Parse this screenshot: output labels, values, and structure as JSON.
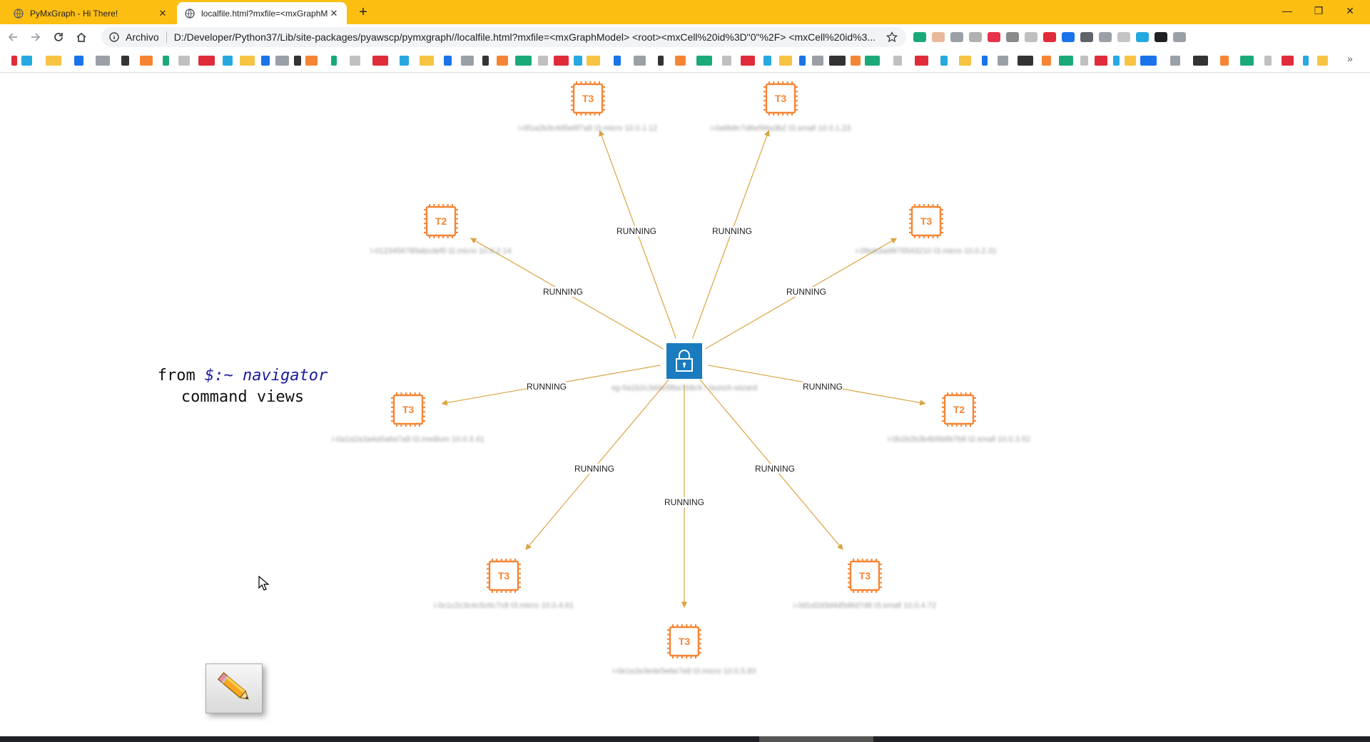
{
  "tabs": [
    {
      "title": "PyMxGraph - Hi There!",
      "active": false
    },
    {
      "title": "localfile.html?mxfile=<mxGraphM",
      "active": true
    }
  ],
  "toolbar": {
    "origin": "Archivo",
    "url": "D:/Developer/Python37/Lib/site-packages/pyawscp/pymxgraph//localfile.html?mxfile=<mxGraphModel> <root><mxCell%20id%3D\"0\"%2F> <mxCell%20id%3..."
  },
  "caption": {
    "line1_prefix": "from",
    "line1_prompt": "$:~",
    "line1_nav": "navigator",
    "line2": "command views"
  },
  "diagram": {
    "center_label": "sg-0a1b2c3d4e5f6a7b8c9 / launch-wizard",
    "nodes": [
      {
        "type": "T3",
        "label": "i-0f1a2b3c4d5e6f7a8 t3.micro 10.0.1.12"
      },
      {
        "type": "T3",
        "label": "i-0a9b8c7d6e5f4a3b2 t3.small 10.0.1.23"
      },
      {
        "type": "T2",
        "label": "i-0123456789abcdef0 t2.micro 10.0.2.14"
      },
      {
        "type": "T3",
        "label": "i-0fedcba9876543210 t3.micro 10.0.2.31"
      },
      {
        "type": "T3",
        "label": "i-0a1a2a3a4a5a6a7a8 t3.medium 10.0.3.41"
      },
      {
        "type": "T2",
        "label": "i-0b1b2b3b4b5b6b7b8 t2.small 10.0.3.52"
      },
      {
        "type": "T3",
        "label": "i-0c1c2c3c4c5c6c7c8 t3.micro 10.0.4.61"
      },
      {
        "type": "T3",
        "label": "i-0d1d2d3d4d5d6d7d8 t3.small 10.0.4.72"
      },
      {
        "type": "T3",
        "label": "i-0e1e2e3e4e5e6e7e8 t3.micro 10.0.5.83"
      }
    ],
    "edge_label": "RUNNING",
    "colors": {
      "instance": "#f58534",
      "security_group": "#1a7bbf",
      "edge": "#d9a441"
    }
  },
  "icons": [
    "globe-icon",
    "close-icon",
    "plus-icon",
    "back-arrow-icon",
    "forward-arrow-icon",
    "reload-icon",
    "home-icon",
    "info-icon",
    "star-icon",
    "lock-icon",
    "pencil-icon",
    "cursor-icon"
  ]
}
